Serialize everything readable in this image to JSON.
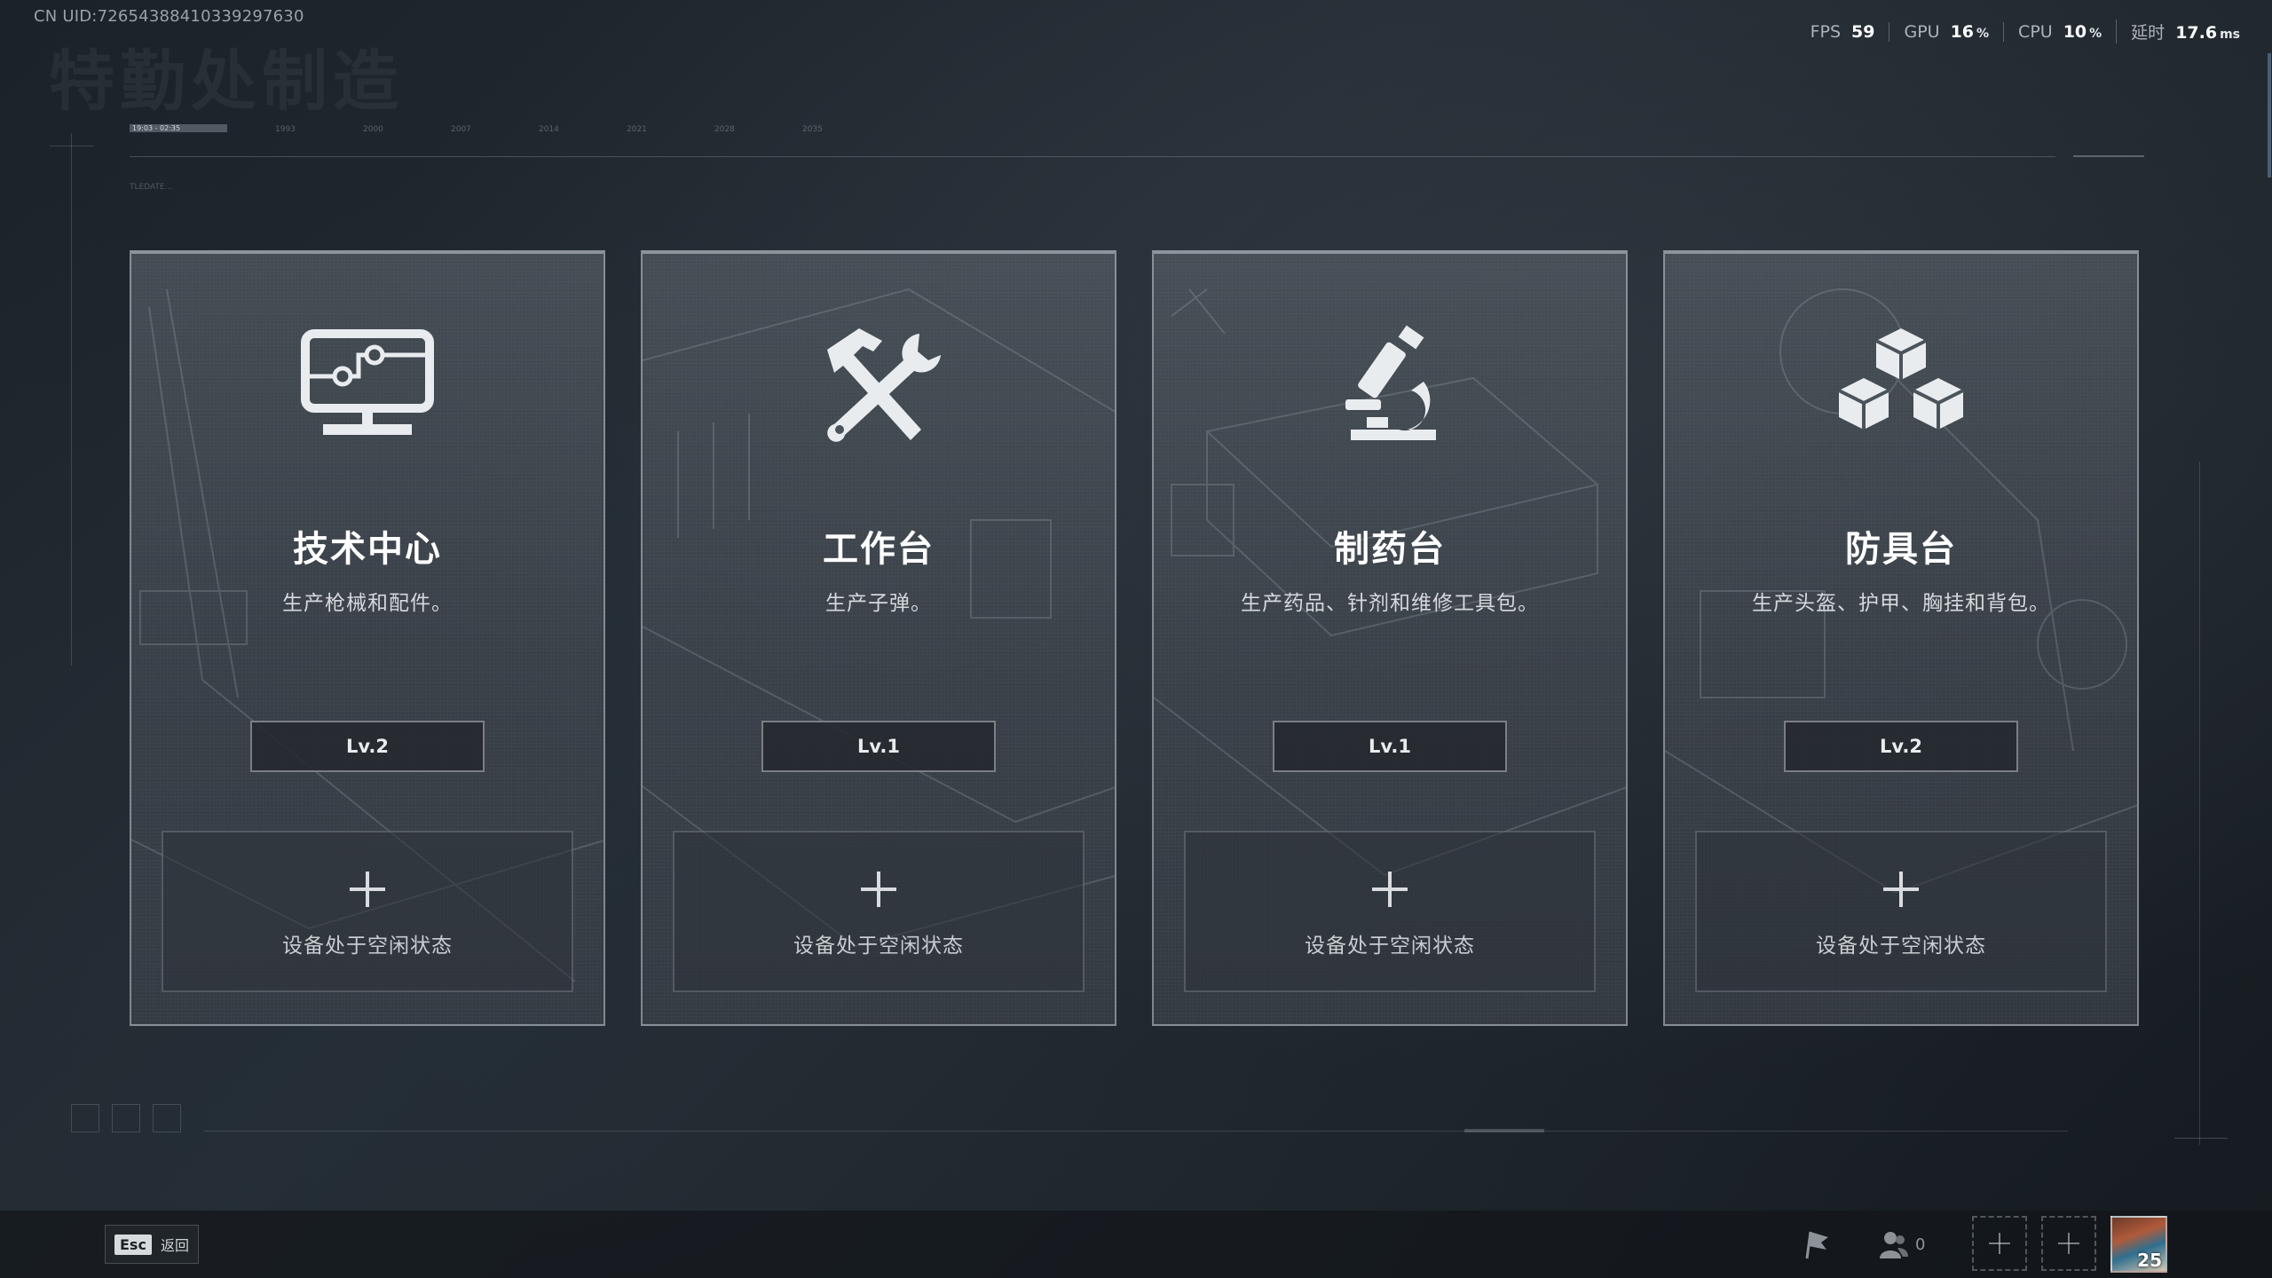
{
  "header": {
    "uid": "CN UID:7265438841033929763​0",
    "watermark_title": "特勤处制造",
    "perf": [
      {
        "label": "FPS",
        "value": "59",
        "unit": ""
      },
      {
        "label": "GPU",
        "value": "16",
        "unit": "%"
      },
      {
        "label": "CPU",
        "value": "10",
        "unit": "%"
      },
      {
        "label": "延时",
        "value": "17.6",
        "unit": "ms"
      }
    ]
  },
  "timeline": {
    "active": "19:03 - 02:35",
    "ticks": [
      "1993",
      "2000",
      "2007",
      "2014",
      "2021",
      "2028",
      "2035"
    ],
    "sub": "TLEDATE..."
  },
  "cards": [
    {
      "title": "技术中心",
      "desc": "生产枪械和配件。",
      "level": "Lv.2",
      "slot_text": "设备处于空闲状态",
      "icon": "computer-icon"
    },
    {
      "title": "工作台",
      "desc": "生产子弹。",
      "level": "Lv.1",
      "slot_text": "设备处于空闲状态",
      "icon": "hammer-wrench-icon"
    },
    {
      "title": "制药台",
      "desc": "生产药品、针剂和维修工具包。",
      "level": "Lv.1",
      "slot_text": "设备处于空闲状态",
      "icon": "microscope-icon"
    },
    {
      "title": "防具台",
      "desc": "生产头盔、护甲、胸挂和背包。",
      "level": "Lv.2",
      "slot_text": "设备处于空闲状态",
      "icon": "cubes-icon"
    }
  ],
  "footer": {
    "esc_key": "Esc",
    "esc_label": "返回",
    "team_count": "0",
    "avatar_level": "25"
  },
  "colors": {
    "background": "#1f262d",
    "card_border": "#bec4ca",
    "text_primary": "#ffffff"
  }
}
